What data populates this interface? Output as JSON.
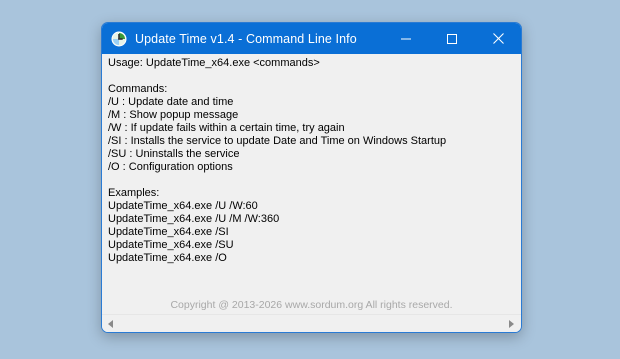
{
  "window": {
    "title": "Update Time v1.4 - Command Line Info",
    "icon": "app-clock-icon",
    "caption_buttons": [
      "minimize-icon",
      "maximize-icon",
      "close-icon"
    ]
  },
  "content": {
    "usage": "Usage: UpdateTime_x64.exe <commands>",
    "commands_header": "Commands:",
    "commands": [
      "/U : Update date and time",
      "/M : Show popup message",
      "/W : If update fails within a certain time, try again",
      "/SI : Installs the service to update Date and Time on Windows Startup",
      "/SU : Uninstalls the service",
      "/O : Configuration options"
    ],
    "examples_header": "Examples:",
    "examples": [
      "UpdateTime_x64.exe /U /W:60",
      "UpdateTime_x64.exe /U /M /W:360",
      "UpdateTime_x64.exe /SI",
      "UpdateTime_x64.exe /SU",
      "UpdateTime_x64.exe /O"
    ],
    "copyright": "Copyright @ 2013-2026 www.sordum.org All rights reserved."
  },
  "colors": {
    "titlebar": "#0a6fd6",
    "desktop": "#a9c4dc",
    "content_bg": "#f0f0f0",
    "copyright": "#a8a8a8"
  }
}
